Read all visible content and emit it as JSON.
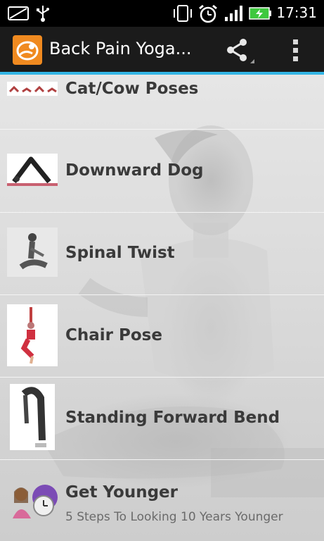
{
  "status_bar": {
    "time": "17:31",
    "icons": [
      "sim-card-icon",
      "usb-icon",
      "vibrate-icon",
      "alarm-icon",
      "signal-icon",
      "battery-charging-icon"
    ],
    "battery_color": "#3ec83e"
  },
  "action_bar": {
    "title": "Back Pain Yoga...",
    "accent_color": "#33b5e5",
    "icon_color": "#f08a20"
  },
  "list": {
    "items": [
      {
        "label": "Cat/Cow Poses",
        "thumb": "cat-cow-thumbnail"
      },
      {
        "label": "Downward Dog",
        "thumb": "downward-dog-thumbnail"
      },
      {
        "label": "Spinal Twist",
        "thumb": "spinal-twist-thumbnail"
      },
      {
        "label": "Chair Pose",
        "thumb": "chair-pose-thumbnail"
      },
      {
        "label": "Standing Forward Bend",
        "thumb": "standing-forward-bend-thumbnail"
      },
      {
        "label": "Get Younger",
        "subtitle": "5 Steps To Looking 10 Years Younger",
        "thumb": "get-younger-thumbnail"
      }
    ]
  }
}
